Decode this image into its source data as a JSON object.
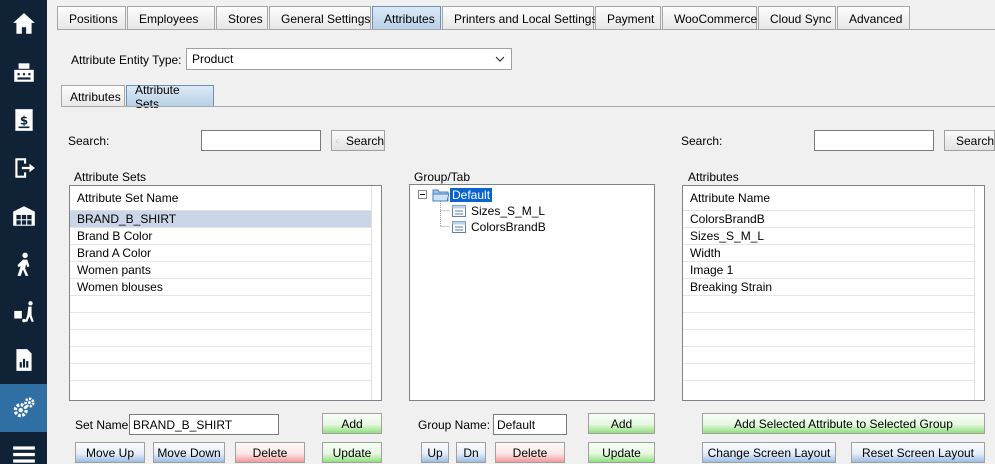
{
  "nav": {
    "items": [
      {
        "icon": "home-icon"
      },
      {
        "icon": "cash-register-icon"
      },
      {
        "icon": "invoice-dollar-icon"
      },
      {
        "icon": "logout-icon"
      },
      {
        "icon": "warehouse-icon"
      },
      {
        "icon": "person-walking-icon"
      },
      {
        "icon": "hand-truck-icon"
      },
      {
        "icon": "report-icon"
      },
      {
        "icon": "gears-icon"
      },
      {
        "icon": "menu-icon"
      }
    ]
  },
  "top_tabs": [
    {
      "label": "Positions"
    },
    {
      "label": "Employees"
    },
    {
      "label": "Stores"
    },
    {
      "label": "General Settings"
    },
    {
      "label": "Attributes"
    },
    {
      "label": "Printers and Local Settings"
    },
    {
      "label": "Payment"
    },
    {
      "label": "WooCommerce"
    },
    {
      "label": "Cloud Sync"
    },
    {
      "label": "Advanced"
    }
  ],
  "entity": {
    "label": "Attribute Entity Type:",
    "value": "Product"
  },
  "sub_tabs": [
    {
      "label": "Attributes"
    },
    {
      "label": "Attribute Sets"
    }
  ],
  "search_left": {
    "label": "Search:",
    "value": "",
    "button": "Search"
  },
  "search_right": {
    "label": "Search:",
    "value": "",
    "button": "Search"
  },
  "attribute_sets": {
    "title": "Attribute Sets",
    "column": "Attribute Set Name",
    "rows": [
      "BRAND_B_SHIRT",
      "Brand B Color",
      "Brand A Color",
      "Women pants",
      "Women blouses"
    ],
    "set_name_label": "Set Name:",
    "set_name_value": "BRAND_B_SHIRT",
    "add": "Add",
    "move_up": "Move Up",
    "move_down": "Move Down",
    "delete": "Delete",
    "update": "Update"
  },
  "group_tab": {
    "title": "Group/Tab",
    "root": "Default",
    "children": [
      "Sizes_S_M_L",
      "ColorsBrandB"
    ],
    "group_name_label": "Group Name:",
    "group_name_value": "Default",
    "add": "Add",
    "up": "Up",
    "dn": "Dn",
    "delete": "Delete",
    "update": "Update"
  },
  "attributes": {
    "title": "Attributes",
    "column": "Attribute Name",
    "rows": [
      "ColorsBrandB",
      "Sizes_S_M_L",
      "Width",
      "Image 1",
      "Breaking Strain"
    ],
    "add_selected": "Add Selected Attribute to Selected Group",
    "change_layout": "Change Screen Layout",
    "reset_layout": "Reset Screen Layout"
  }
}
